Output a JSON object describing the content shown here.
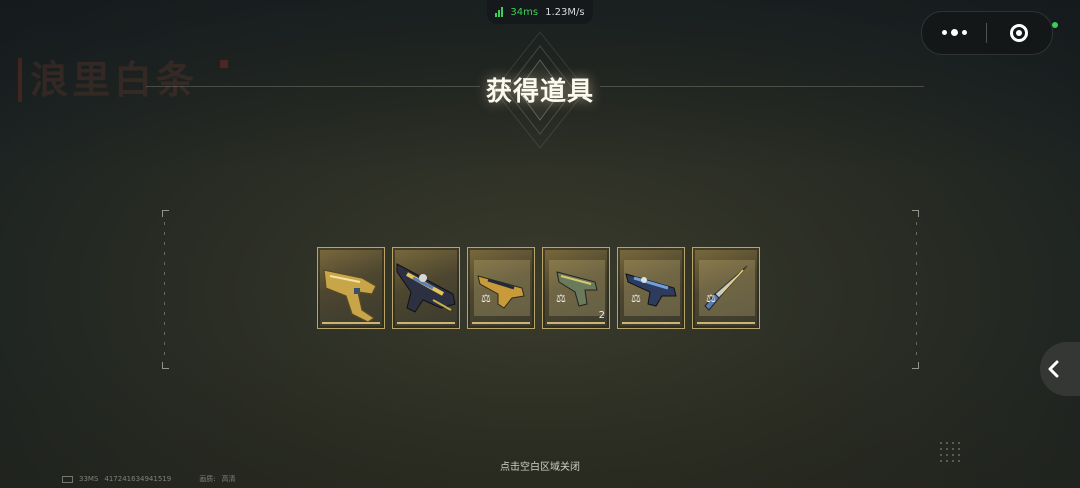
{
  "network": {
    "ping": "34ms",
    "speed": "1.23M/s"
  },
  "header": {
    "title": "获得道具"
  },
  "background": {
    "faded_title": "浪里白条"
  },
  "items": [
    {
      "name": "gold-pistol",
      "count": ""
    },
    {
      "name": "camo-sniper-rifle",
      "count": ""
    },
    {
      "name": "rifle-blueprint",
      "count": ""
    },
    {
      "name": "pistol-blueprint",
      "count": "2"
    },
    {
      "name": "blue-rifle-blueprint",
      "count": ""
    },
    {
      "name": "dagger-blueprint",
      "count": ""
    }
  ],
  "hint": "点击空白区域关闭",
  "footer": {
    "fps": "33MS",
    "uid": "417241634941519",
    "quality_label": "画质:",
    "quality_value": "高清"
  },
  "colors": {
    "accent_green": "#3ccf5b",
    "item_border": "#b9a46a"
  },
  "icons": {
    "more": "more-dots-icon",
    "close": "capsule-close-icon",
    "side": "chevron-left-icon",
    "blueprint": "blueprint-compass-icon"
  }
}
